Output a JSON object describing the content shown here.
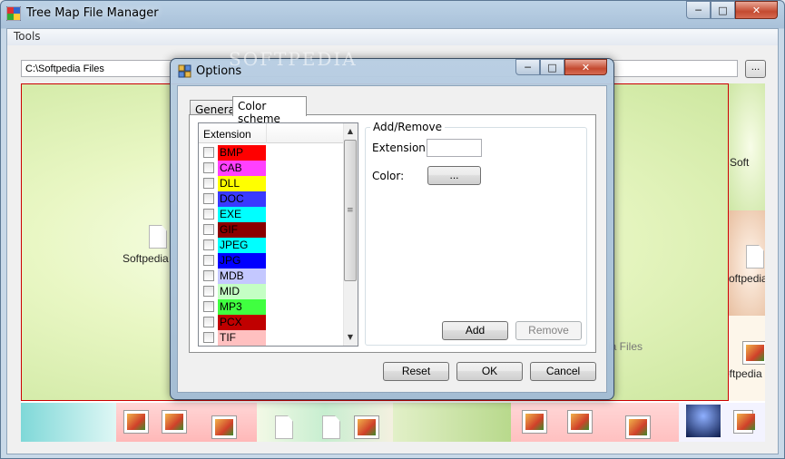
{
  "window": {
    "title": "Tree Map File Manager"
  },
  "menu": {
    "tools": "Tools"
  },
  "path": {
    "value": "C:\\Softpedia Files"
  },
  "browse_button": "...",
  "treemap": {
    "labels": {
      "center": "Softpedia",
      "right_top": "Soft",
      "right_mid": "oftpedia",
      "right_low": "oftpedia",
      "behind": "ia Files"
    }
  },
  "watermark": "SOFTPEDIA",
  "dialog": {
    "title": "Options",
    "tabs": {
      "general": "General",
      "color_scheme": "Color scheme"
    },
    "list": {
      "header": "Extension",
      "items": [
        {
          "ext": "BMP",
          "color": "#ff0000"
        },
        {
          "ext": "CAB",
          "color": "#ff40ff"
        },
        {
          "ext": "DLL",
          "color": "#ffff00"
        },
        {
          "ext": "DOC",
          "color": "#3a3aff"
        },
        {
          "ext": "EXE",
          "color": "#00ffff"
        },
        {
          "ext": "GIF",
          "color": "#8b0000"
        },
        {
          "ext": "JPEG",
          "color": "#00ffff"
        },
        {
          "ext": "JPG",
          "color": "#0000ff"
        },
        {
          "ext": "MDB",
          "color": "#c4c8ff"
        },
        {
          "ext": "MID",
          "color": "#c4ffc4"
        },
        {
          "ext": "MP3",
          "color": "#40ff40"
        },
        {
          "ext": "PCX",
          "color": "#c00000"
        },
        {
          "ext": "TIF",
          "color": "#ffc0c0"
        }
      ]
    },
    "add_remove": {
      "group_title": "Add/Remove",
      "extension_label": "Extension:",
      "extension_value": "",
      "color_label": "Color:",
      "color_button": "...",
      "add_button": "Add",
      "remove_button": "Remove"
    },
    "buttons": {
      "reset": "Reset",
      "ok": "OK",
      "cancel": "Cancel"
    }
  }
}
